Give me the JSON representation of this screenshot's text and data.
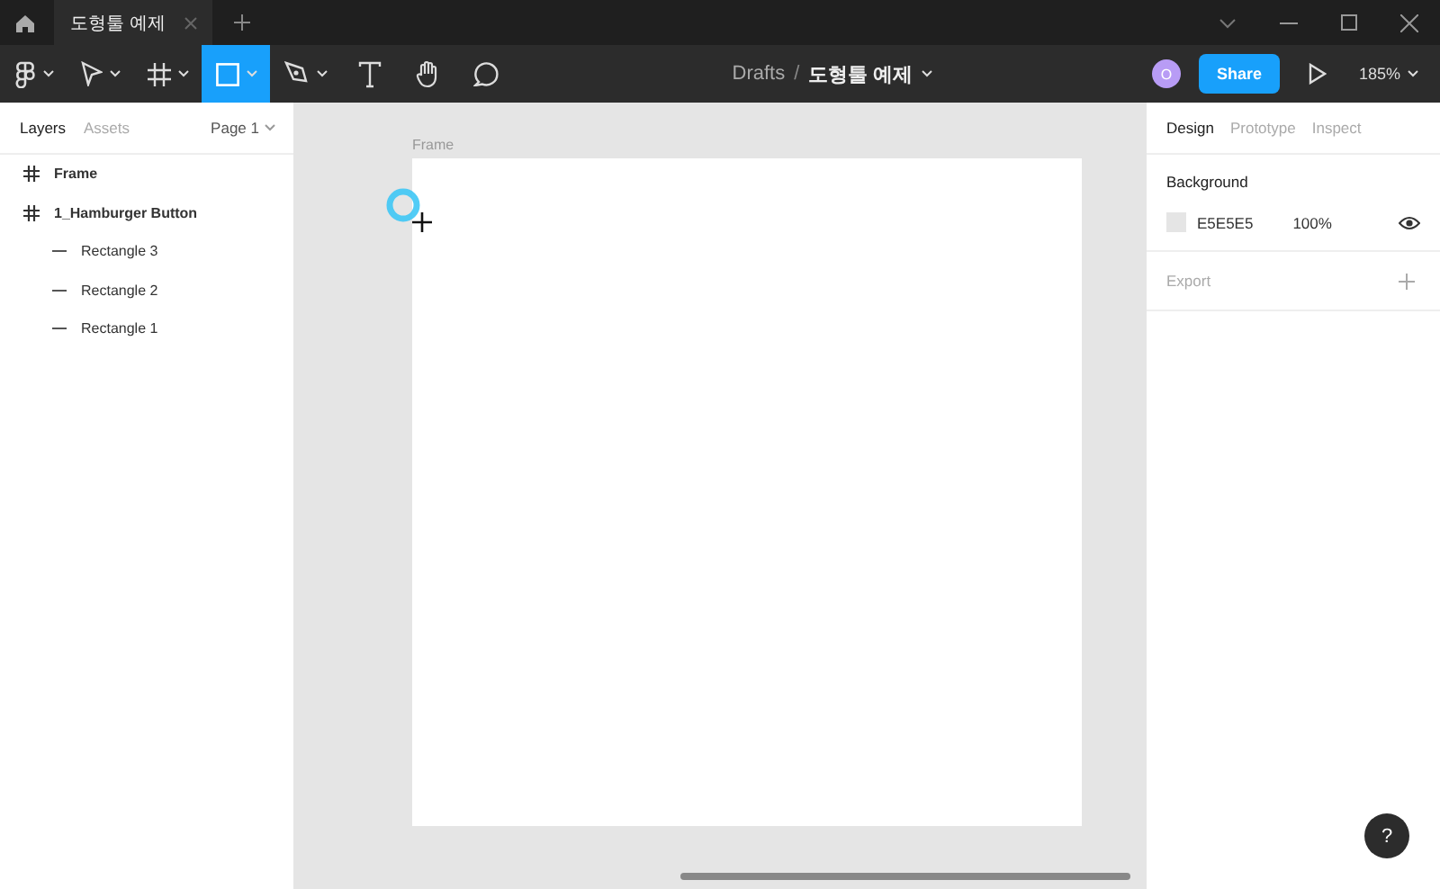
{
  "title_bar": {
    "tabs": [
      {
        "label": "도형툴 예제",
        "selected": true
      }
    ]
  },
  "toolbar": {
    "tools": [
      {
        "kind": "main-menu",
        "selected": false,
        "caret": true
      },
      {
        "kind": "move",
        "selected": false,
        "caret": true
      },
      {
        "kind": "frame",
        "selected": false,
        "caret": true
      },
      {
        "kind": "rectangle",
        "selected": true,
        "caret": true
      },
      {
        "kind": "pen",
        "selected": false,
        "caret": true
      },
      {
        "kind": "text",
        "selected": false,
        "caret": false
      },
      {
        "kind": "hand",
        "selected": false,
        "caret": false
      },
      {
        "kind": "comment",
        "selected": false,
        "caret": false
      }
    ],
    "breadcrumb": {
      "folder": "Drafts",
      "separator": "/",
      "file": "도형툴 예제"
    },
    "avatar_initial": "O",
    "share": "Share",
    "zoom": "185%"
  },
  "left_panel": {
    "tabs": [
      {
        "label": "Layers",
        "selected": true
      },
      {
        "label": "Assets",
        "selected": false
      }
    ],
    "page": "Page 1",
    "layers": [
      {
        "name": "Frame",
        "kind": "frame"
      },
      {
        "name": "1_Hamburger Button",
        "kind": "frame",
        "children": [
          {
            "name": "Rectangle 3",
            "kind": "rectangle"
          },
          {
            "name": "Rectangle 2",
            "kind": "rectangle"
          },
          {
            "name": "Rectangle 1",
            "kind": "rectangle"
          }
        ]
      }
    ]
  },
  "canvas": {
    "frame_label": "Frame"
  },
  "right_panel": {
    "tabs": [
      {
        "label": "Design",
        "selected": true
      },
      {
        "label": "Prototype",
        "selected": false
      },
      {
        "label": "Inspect",
        "selected": false
      }
    ],
    "background": {
      "title": "Background",
      "color": "#e5e5e5",
      "hex": "E5E5E5",
      "opacity": "100%"
    },
    "export": {
      "title": "Export"
    }
  },
  "help": "?"
}
